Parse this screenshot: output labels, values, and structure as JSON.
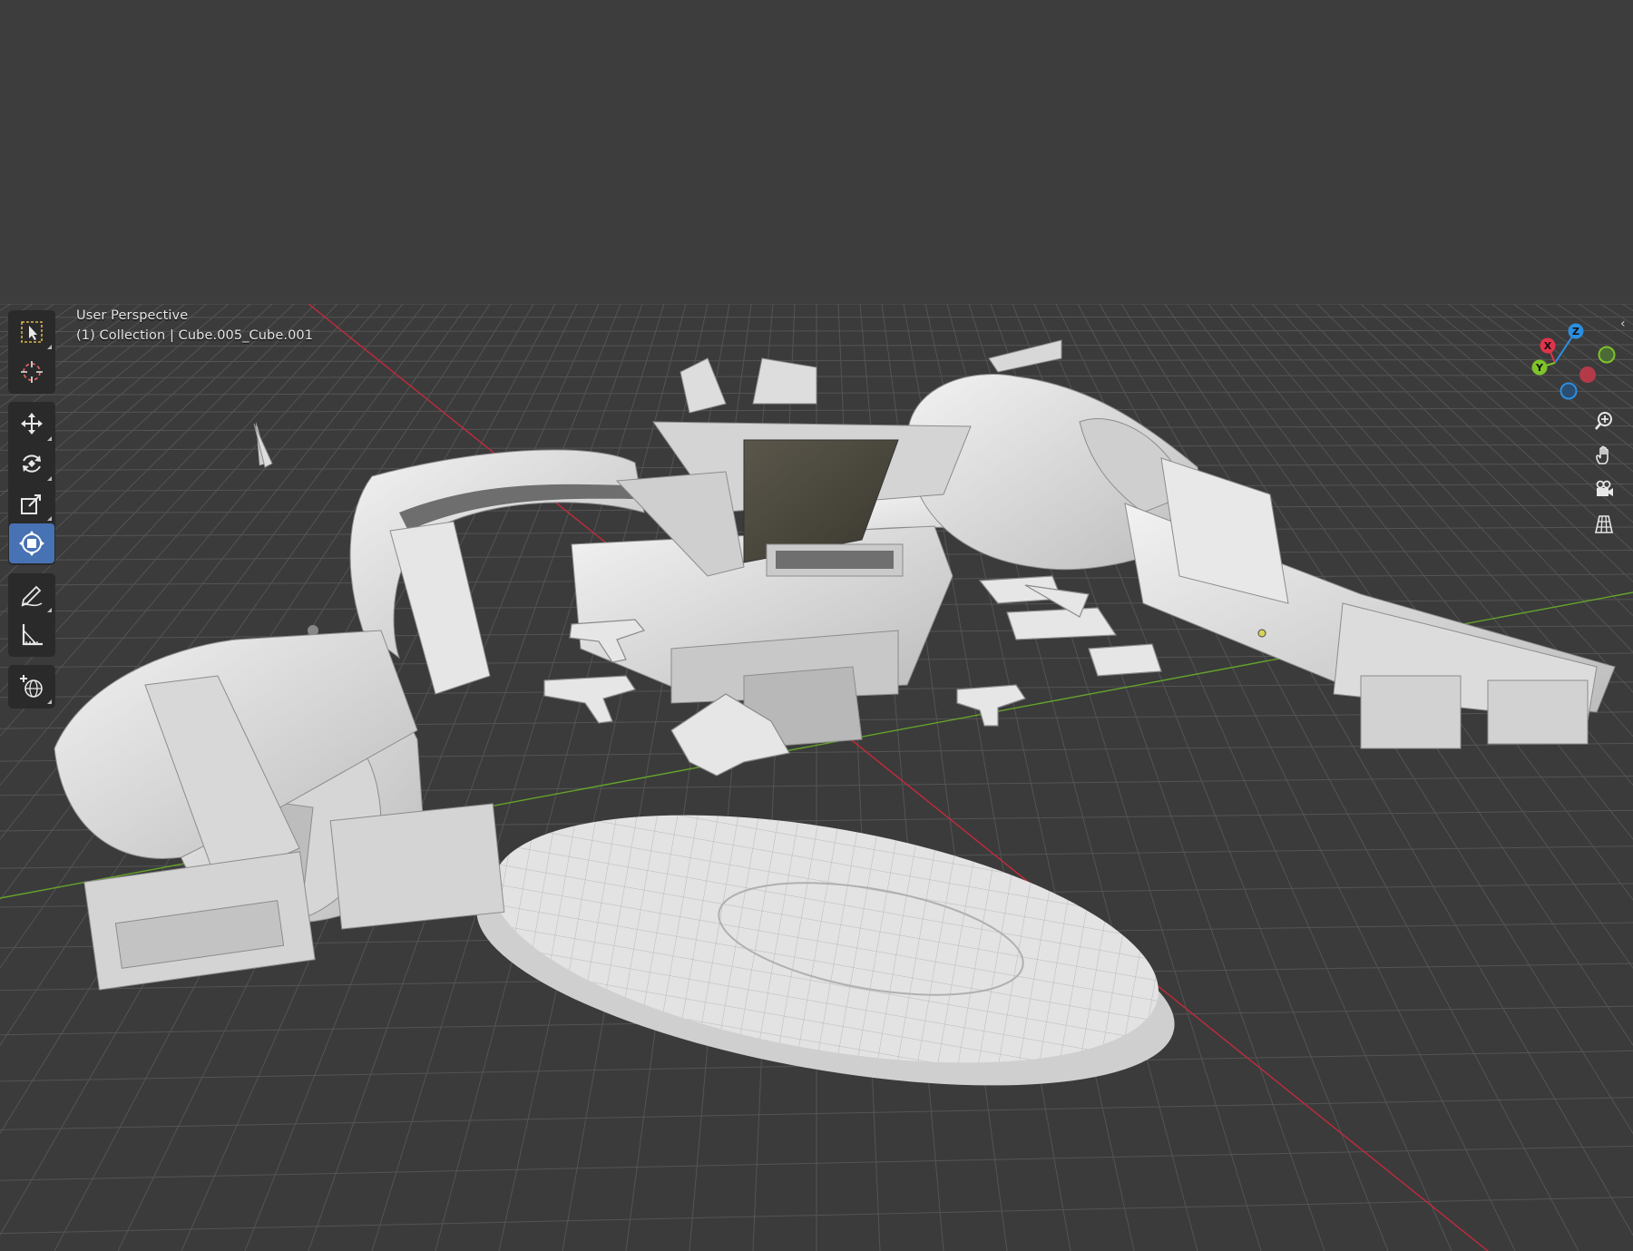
{
  "viewport": {
    "view_name": "User Perspective",
    "context": "(1) Collection | Cube.005_Cube.001"
  },
  "toolbar": {
    "groups": [
      [
        {
          "name": "select-box",
          "icon": "select-box-icon"
        },
        {
          "name": "cursor",
          "icon": "cursor-crosshair-icon"
        }
      ],
      [
        {
          "name": "move",
          "icon": "move-arrows-icon"
        },
        {
          "name": "rotate",
          "icon": "rotate-icon"
        },
        {
          "name": "scale",
          "icon": "scale-icon"
        },
        {
          "name": "transform",
          "icon": "transform-icon",
          "active": true
        }
      ],
      [
        {
          "name": "annotate",
          "icon": "annotate-pencil-icon"
        },
        {
          "name": "measure",
          "icon": "measure-ruler-icon"
        }
      ],
      [
        {
          "name": "add-cube",
          "icon": "add-object-icon"
        }
      ]
    ]
  },
  "gizmo": {
    "x_label": "X",
    "y_label": "Y",
    "z_label": "Z",
    "colors": {
      "x": "#e0344a",
      "y": "#7ec42a",
      "z": "#2c8fe0"
    }
  },
  "nav": [
    {
      "name": "zoom",
      "icon": "zoom-magnifier-icon"
    },
    {
      "name": "pan",
      "icon": "hand-icon"
    },
    {
      "name": "camera",
      "icon": "camera-icon"
    },
    {
      "name": "ortho",
      "icon": "grid-perspective-icon"
    }
  ],
  "colors": {
    "accent": "#4772b3",
    "x_axis": "#c42a3c",
    "y_axis": "#64a32a",
    "grid": "#505050"
  }
}
